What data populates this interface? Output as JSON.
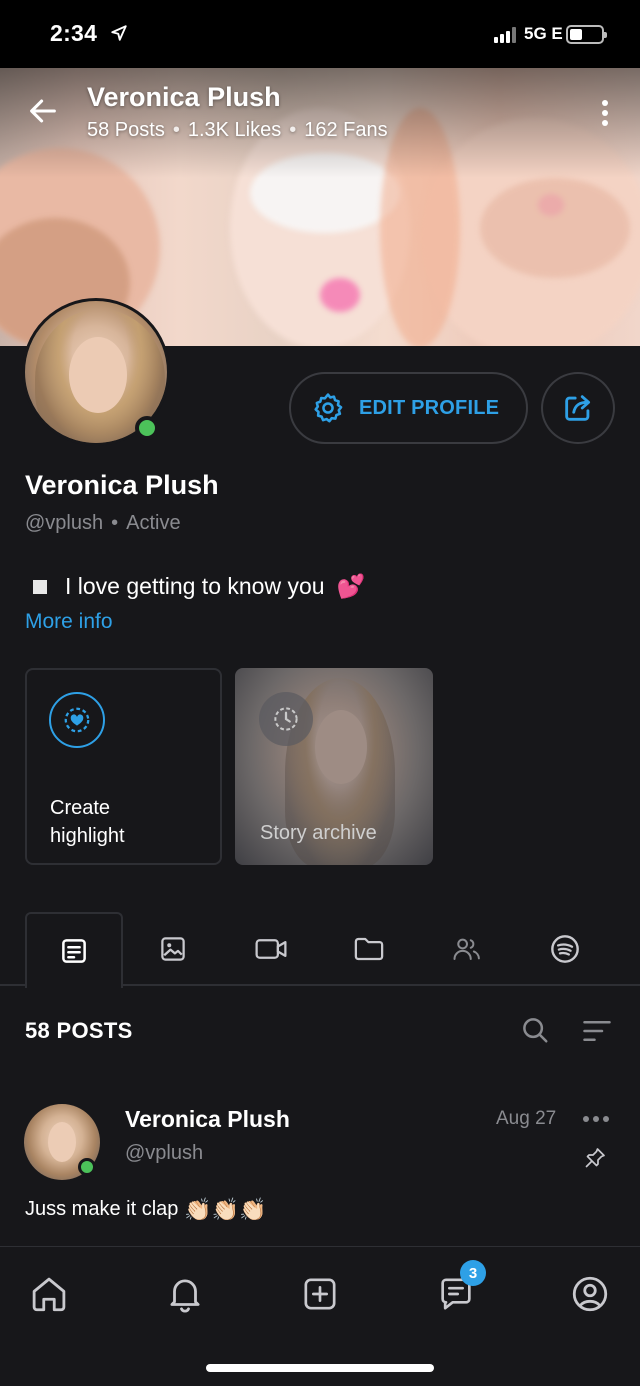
{
  "status_bar": {
    "time": "2:34",
    "network": "5G E"
  },
  "header": {
    "name": "Veronica Plush",
    "stats": {
      "posts": "58 Posts",
      "likes": "1.3K Likes",
      "fans": "162 Fans"
    }
  },
  "profile": {
    "edit_label": "EDIT PROFILE",
    "name": "Veronica Plush",
    "handle": "@vplush",
    "status": "Active",
    "bio": "I love getting to know you",
    "bio_emoji": "💕",
    "more_info": "More info"
  },
  "highlights": {
    "create_label": "Create highlight",
    "archive_label": "Story archive"
  },
  "tabs": [
    "posts",
    "photos",
    "videos",
    "collections",
    "subscribers",
    "spotify"
  ],
  "posts_section": {
    "count_label": "58 POSTS"
  },
  "post": {
    "name": "Veronica Plush",
    "handle": "@vplush",
    "date": "Aug 27",
    "text": "Juss make it clap",
    "emoji": "👏🏻👏🏻👏🏻"
  },
  "bottom_nav": {
    "messages_badge": "3"
  },
  "colors": {
    "accent": "#2ea0e6",
    "online": "#4cc25a",
    "background": "#17171a",
    "border": "#2e2f34"
  }
}
